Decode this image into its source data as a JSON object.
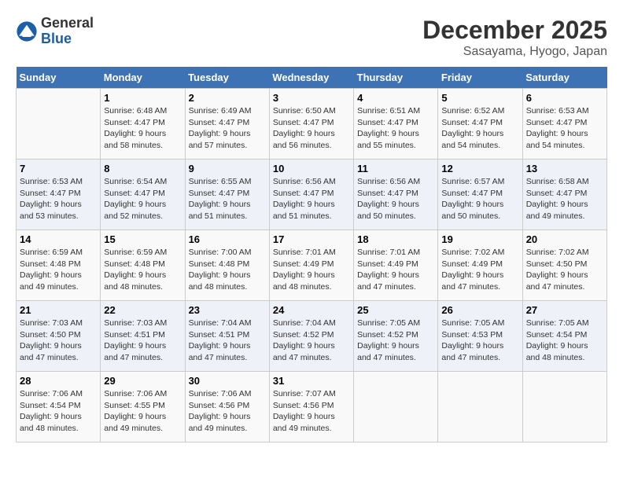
{
  "header": {
    "logo_general": "General",
    "logo_blue": "Blue",
    "title": "December 2025",
    "subtitle": "Sasayama, Hyogo, Japan"
  },
  "weekdays": [
    "Sunday",
    "Monday",
    "Tuesday",
    "Wednesday",
    "Thursday",
    "Friday",
    "Saturday"
  ],
  "weeks": [
    [
      {
        "day": "",
        "sunrise": "",
        "sunset": "",
        "daylight": ""
      },
      {
        "day": "1",
        "sunrise": "6:48 AM",
        "sunset": "4:47 PM",
        "daylight": "9 hours and 58 minutes."
      },
      {
        "day": "2",
        "sunrise": "6:49 AM",
        "sunset": "4:47 PM",
        "daylight": "9 hours and 57 minutes."
      },
      {
        "day": "3",
        "sunrise": "6:50 AM",
        "sunset": "4:47 PM",
        "daylight": "9 hours and 56 minutes."
      },
      {
        "day": "4",
        "sunrise": "6:51 AM",
        "sunset": "4:47 PM",
        "daylight": "9 hours and 55 minutes."
      },
      {
        "day": "5",
        "sunrise": "6:52 AM",
        "sunset": "4:47 PM",
        "daylight": "9 hours and 54 minutes."
      },
      {
        "day": "6",
        "sunrise": "6:53 AM",
        "sunset": "4:47 PM",
        "daylight": "9 hours and 54 minutes."
      }
    ],
    [
      {
        "day": "7",
        "sunrise": "6:53 AM",
        "sunset": "4:47 PM",
        "daylight": "9 hours and 53 minutes."
      },
      {
        "day": "8",
        "sunrise": "6:54 AM",
        "sunset": "4:47 PM",
        "daylight": "9 hours and 52 minutes."
      },
      {
        "day": "9",
        "sunrise": "6:55 AM",
        "sunset": "4:47 PM",
        "daylight": "9 hours and 51 minutes."
      },
      {
        "day": "10",
        "sunrise": "6:56 AM",
        "sunset": "4:47 PM",
        "daylight": "9 hours and 51 minutes."
      },
      {
        "day": "11",
        "sunrise": "6:56 AM",
        "sunset": "4:47 PM",
        "daylight": "9 hours and 50 minutes."
      },
      {
        "day": "12",
        "sunrise": "6:57 AM",
        "sunset": "4:47 PM",
        "daylight": "9 hours and 50 minutes."
      },
      {
        "day": "13",
        "sunrise": "6:58 AM",
        "sunset": "4:47 PM",
        "daylight": "9 hours and 49 minutes."
      }
    ],
    [
      {
        "day": "14",
        "sunrise": "6:59 AM",
        "sunset": "4:48 PM",
        "daylight": "9 hours and 49 minutes."
      },
      {
        "day": "15",
        "sunrise": "6:59 AM",
        "sunset": "4:48 PM",
        "daylight": "9 hours and 48 minutes."
      },
      {
        "day": "16",
        "sunrise": "7:00 AM",
        "sunset": "4:48 PM",
        "daylight": "9 hours and 48 minutes."
      },
      {
        "day": "17",
        "sunrise": "7:01 AM",
        "sunset": "4:49 PM",
        "daylight": "9 hours and 48 minutes."
      },
      {
        "day": "18",
        "sunrise": "7:01 AM",
        "sunset": "4:49 PM",
        "daylight": "9 hours and 47 minutes."
      },
      {
        "day": "19",
        "sunrise": "7:02 AM",
        "sunset": "4:49 PM",
        "daylight": "9 hours and 47 minutes."
      },
      {
        "day": "20",
        "sunrise": "7:02 AM",
        "sunset": "4:50 PM",
        "daylight": "9 hours and 47 minutes."
      }
    ],
    [
      {
        "day": "21",
        "sunrise": "7:03 AM",
        "sunset": "4:50 PM",
        "daylight": "9 hours and 47 minutes."
      },
      {
        "day": "22",
        "sunrise": "7:03 AM",
        "sunset": "4:51 PM",
        "daylight": "9 hours and 47 minutes."
      },
      {
        "day": "23",
        "sunrise": "7:04 AM",
        "sunset": "4:51 PM",
        "daylight": "9 hours and 47 minutes."
      },
      {
        "day": "24",
        "sunrise": "7:04 AM",
        "sunset": "4:52 PM",
        "daylight": "9 hours and 47 minutes."
      },
      {
        "day": "25",
        "sunrise": "7:05 AM",
        "sunset": "4:52 PM",
        "daylight": "9 hours and 47 minutes."
      },
      {
        "day": "26",
        "sunrise": "7:05 AM",
        "sunset": "4:53 PM",
        "daylight": "9 hours and 47 minutes."
      },
      {
        "day": "27",
        "sunrise": "7:05 AM",
        "sunset": "4:54 PM",
        "daylight": "9 hours and 48 minutes."
      }
    ],
    [
      {
        "day": "28",
        "sunrise": "7:06 AM",
        "sunset": "4:54 PM",
        "daylight": "9 hours and 48 minutes."
      },
      {
        "day": "29",
        "sunrise": "7:06 AM",
        "sunset": "4:55 PM",
        "daylight": "9 hours and 49 minutes."
      },
      {
        "day": "30",
        "sunrise": "7:06 AM",
        "sunset": "4:56 PM",
        "daylight": "9 hours and 49 minutes."
      },
      {
        "day": "31",
        "sunrise": "7:07 AM",
        "sunset": "4:56 PM",
        "daylight": "9 hours and 49 minutes."
      },
      {
        "day": "",
        "sunrise": "",
        "sunset": "",
        "daylight": ""
      },
      {
        "day": "",
        "sunrise": "",
        "sunset": "",
        "daylight": ""
      },
      {
        "day": "",
        "sunrise": "",
        "sunset": "",
        "daylight": ""
      }
    ]
  ]
}
